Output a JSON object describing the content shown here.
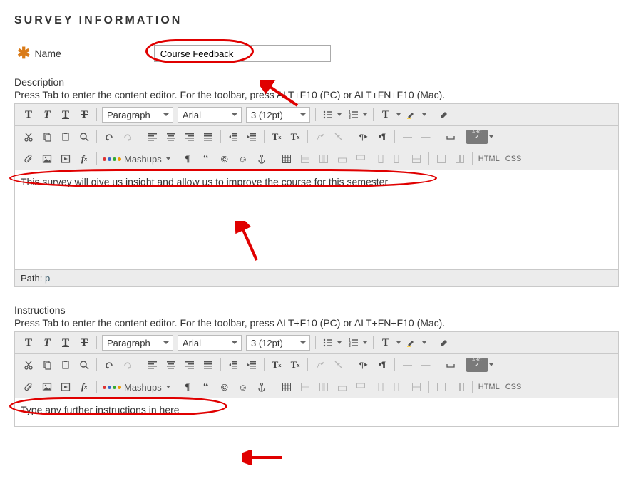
{
  "section_title": "SURVEY INFORMATION",
  "name_label": "Name",
  "name_value": "Course Feedback",
  "description_label": "Description",
  "instructions_label": "Instructions",
  "editor_hint": "Press Tab to enter the content editor. For the toolbar, press ALT+F10 (PC) or ALT+FN+F10 (Mac).",
  "toolbar": {
    "format": "Paragraph",
    "font": "Arial",
    "size": "3 (12pt)",
    "mashups": "Mashups",
    "html": "HTML",
    "css": "CSS",
    "path_label": "Path:",
    "path_value": "p"
  },
  "description_content": "This survey will give us insight and allow us to improve the course for this semester",
  "instructions_content": "Type any further instructions in here"
}
